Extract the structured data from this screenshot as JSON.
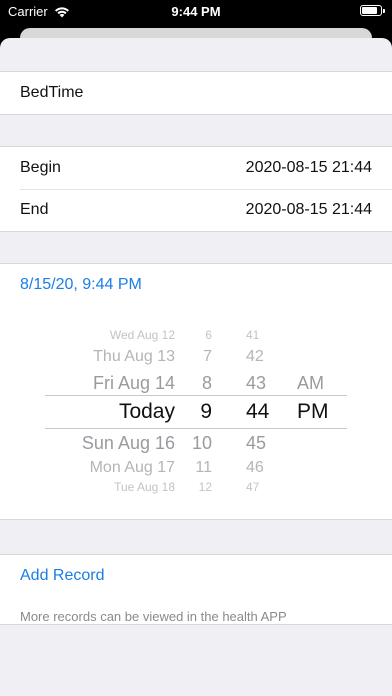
{
  "status_bar": {
    "carrier": "Carrier",
    "time": "9:44 PM"
  },
  "form": {
    "name_value": "BedTime",
    "begin_label": "Begin",
    "begin_value": "2020-08-15 21:44",
    "end_label": "End",
    "end_value": "2020-08-15 21:44",
    "picker_display": "8/15/20, 9:44 PM"
  },
  "picker": {
    "rows": [
      {
        "date": "Wed Aug 12",
        "hour": "6",
        "minute": "41",
        "ampm": ""
      },
      {
        "date": "Thu Aug 13",
        "hour": "7",
        "minute": "42",
        "ampm": ""
      },
      {
        "date": "Fri Aug 14",
        "hour": "8",
        "minute": "43",
        "ampm": "AM"
      },
      {
        "date": "Today",
        "hour": "9",
        "minute": "44",
        "ampm": "PM"
      },
      {
        "date": "Sun Aug 16",
        "hour": "10",
        "minute": "45",
        "ampm": ""
      },
      {
        "date": "Mon Aug 17",
        "hour": "11",
        "minute": "46",
        "ampm": ""
      },
      {
        "date": "Tue Aug 18",
        "hour": "12",
        "minute": "47",
        "ampm": ""
      }
    ]
  },
  "actions": {
    "add_record": "Add Record",
    "note": "More records can be viewed in the health APP"
  },
  "colors": {
    "accent": "#1a7ee6",
    "background": "#efeff4"
  }
}
